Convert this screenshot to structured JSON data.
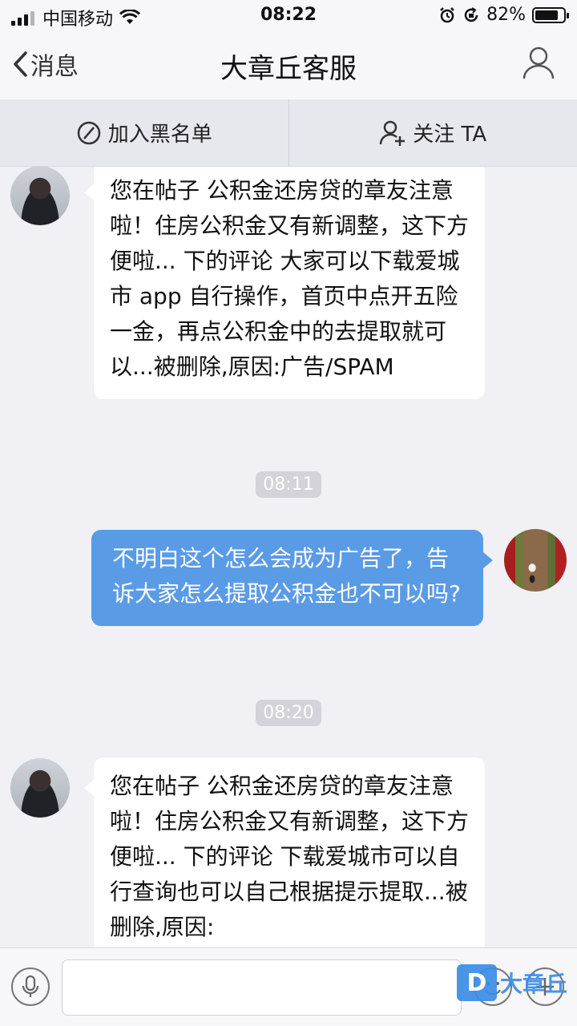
{
  "status_bar": {
    "carrier": "中国移动",
    "time": "08:22",
    "battery_percent": "82%",
    "battery_level": 0.82,
    "icons": [
      "signal-icon",
      "wifi-icon",
      "alarm-icon",
      "rotation-lock-icon",
      "battery-icon"
    ]
  },
  "nav": {
    "back_label": "消息",
    "title": "大章丘客服"
  },
  "actions": {
    "block_label": "加入黑名单",
    "follow_label": "关注 TA"
  },
  "messages": [
    {
      "sender": "other",
      "text": "您在帖子 公积金还房贷的章友注意啦！住房公积金又有新调整，这下方便啦... 下的评论 大家可以下载爱城市 app 自行操作，首页中点开五险一金，再点公积金中的去提取就可以...被删除,原因:广告/SPAM"
    },
    {
      "timestamp": "08:11"
    },
    {
      "sender": "self",
      "text": "不明白这个怎么会成为广告了，告诉大家怎么提取公积金也不可以吗?"
    },
    {
      "timestamp": "08:20"
    },
    {
      "sender": "other",
      "text": "您在帖子 公积金还房贷的章友注意啦！住房公积金又有新调整，这下方便啦... 下的评论 下载爱城市可以自行查询也可以自己根据提示提取...被删除,原因:"
    }
  ],
  "input_bar": {
    "placeholder": "",
    "watermark_logo": "D",
    "watermark_text": "大章丘"
  },
  "colors": {
    "self_bubble": "#5a9be6",
    "other_bubble": "#ffffff",
    "background": "#f0f0f5",
    "watermark": "#3c8de6"
  }
}
